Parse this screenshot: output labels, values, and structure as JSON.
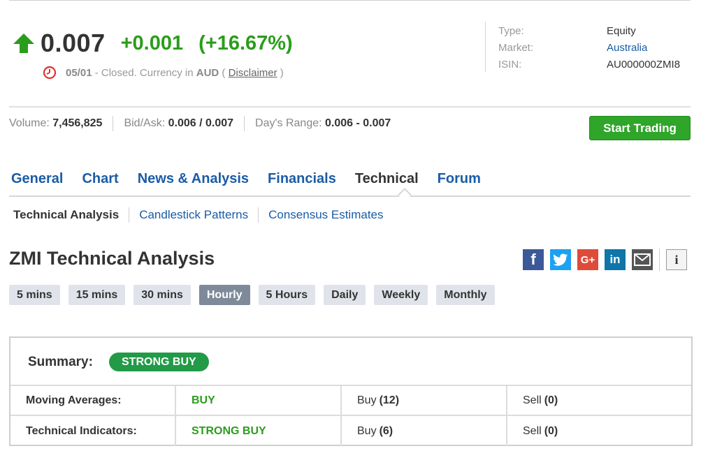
{
  "quote": {
    "price": "0.007",
    "change": "+0.001",
    "change_pct": "(+16.67%)",
    "date": "05/01",
    "status_text": " - Closed. Currency in ",
    "currency": "AUD",
    "paren_open": " ( ",
    "disclaimer": "Disclaimer",
    "paren_close": " )"
  },
  "meta": {
    "type_label": "Type:",
    "type_value": "Equity",
    "market_label": "Market:",
    "market_value": "Australia",
    "isin_label": "ISIN:",
    "isin_value": "AU000000ZMI8"
  },
  "stats": {
    "volume_label": "Volume: ",
    "volume_value": "7,456,825",
    "bidask_label": "Bid/Ask: ",
    "bidask_value": "0.006 / 0.007",
    "range_label": "Day's Range: ",
    "range_value": "0.006 - 0.007"
  },
  "start_trading": "Start Trading",
  "tabs": [
    {
      "label": "General"
    },
    {
      "label": "Chart"
    },
    {
      "label": "News & Analysis"
    },
    {
      "label": "Financials"
    },
    {
      "label": "Technical"
    },
    {
      "label": "Forum"
    }
  ],
  "subtabs": [
    {
      "label": "Technical Analysis"
    },
    {
      "label": "Candlestick Patterns"
    },
    {
      "label": "Consensus Estimates"
    }
  ],
  "heading": "ZMI Technical Analysis",
  "timeframes": [
    {
      "label": "5 mins"
    },
    {
      "label": "15 mins"
    },
    {
      "label": "30 mins"
    },
    {
      "label": "Hourly"
    },
    {
      "label": "5 Hours"
    },
    {
      "label": "Daily"
    },
    {
      "label": "Weekly"
    },
    {
      "label": "Monthly"
    }
  ],
  "summary": {
    "label": "Summary:",
    "badge": "STRONG BUY",
    "rows": [
      {
        "name": "Moving Averages:",
        "signal": "BUY",
        "buy_label": "Buy",
        "buy_count": "(12)",
        "sell_label": "Sell",
        "sell_count": "(0)"
      },
      {
        "name": "Technical Indicators:",
        "signal": "STRONG BUY",
        "buy_label": "Buy",
        "buy_count": "(6)",
        "sell_label": "Sell",
        "sell_count": "(0)"
      }
    ]
  },
  "colors": {
    "positive": "#2a9d1b",
    "link": "#1a5ca6",
    "badge": "#229a47",
    "active_timeframe": "#7e8a99"
  },
  "icons": [
    "arrow-up-icon",
    "clock-icon",
    "facebook-icon",
    "twitter-icon",
    "google-plus-icon",
    "linkedin-icon",
    "email-icon",
    "info-icon"
  ]
}
